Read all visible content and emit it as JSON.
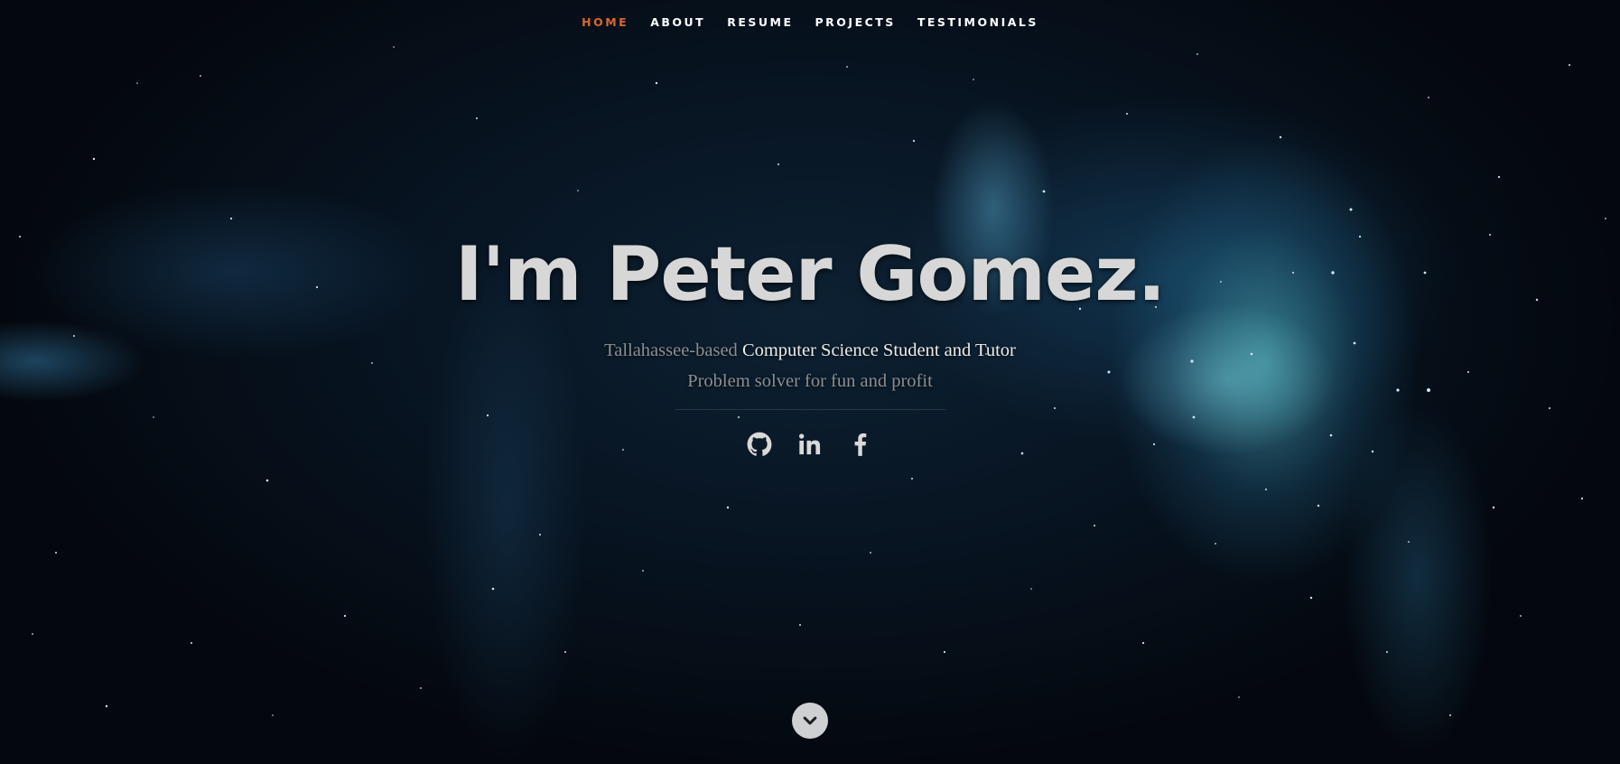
{
  "nav": {
    "items": [
      {
        "label": "HOME",
        "active": true
      },
      {
        "label": "ABOUT",
        "active": false
      },
      {
        "label": "RESUME",
        "active": false
      },
      {
        "label": "PROJECTS",
        "active": false
      },
      {
        "label": "TESTIMONIALS",
        "active": false
      }
    ]
  },
  "banner": {
    "headline": "I'm Peter Gomez.",
    "location_prefix": "Tallahassee-based",
    "role": "Computer Science Student and Tutor",
    "tagline": "Problem solver for fun and profit"
  },
  "social": {
    "icons": [
      "github-icon",
      "linkedin-icon",
      "facebook-icon"
    ]
  },
  "scroll": {
    "icon": "chevron-down-icon"
  },
  "colors": {
    "accent": "#d9672f",
    "headline": "#d7d7d7",
    "muted_text": "#8c8f93",
    "highlight_text": "#ececec",
    "background": "#05080d"
  }
}
